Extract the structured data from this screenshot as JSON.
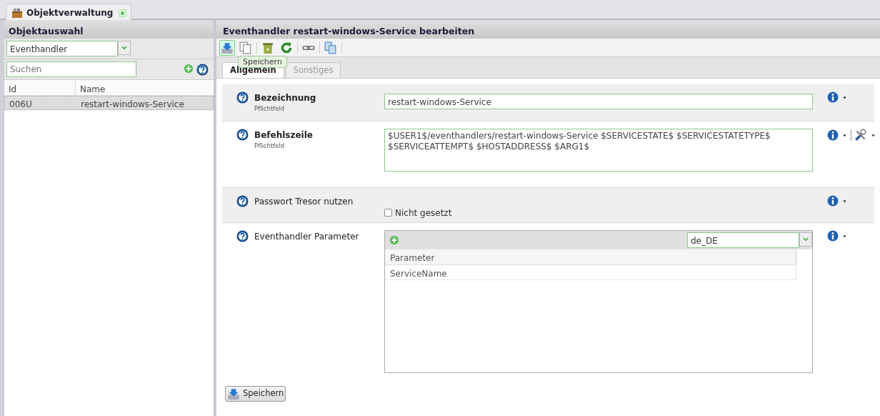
{
  "tab": {
    "label": "Objektverwaltung"
  },
  "left": {
    "title": "Objektauswahl",
    "type_select": {
      "value": "Eventhandler"
    },
    "search": {
      "placeholder": "Suchen"
    },
    "columns": [
      "Id",
      "Name"
    ],
    "rows": [
      {
        "cells": [
          "006U",
          "restart-windows-Service"
        ],
        "selected": true
      }
    ]
  },
  "editor": {
    "title": "Eventhandler restart-windows-Service bearbeiten",
    "toolbar": [
      {
        "kind": "save",
        "hovered": true
      },
      {
        "kind": "copy",
        "hovered": false
      },
      {
        "kind": "sep"
      },
      {
        "kind": "archive",
        "hovered": false
      },
      {
        "kind": "refresh",
        "hovered": false
      },
      {
        "kind": "sep"
      },
      {
        "kind": "link",
        "hovered": false
      },
      {
        "kind": "sep"
      },
      {
        "kind": "duplicate",
        "hovered": false
      },
      {
        "kind": "sep"
      }
    ],
    "tooltip": "Speichern",
    "tabs": [
      {
        "label": "Allgemein",
        "selected": true
      },
      {
        "label": "Sonstiges",
        "selected": false
      }
    ],
    "fields": [
      {
        "kind": "text",
        "label": "Bezeichnung",
        "required": true,
        "hint": "Pflichtfeld",
        "value": "restart-windows-Service",
        "tools": false
      },
      {
        "kind": "textarea",
        "label": "Befehlszeile",
        "required": true,
        "hint": "Pflichtfeld",
        "value": "$USER1$/eventhandlers/restart-windows-Service $SERVICESTATE$ $SERVICESTATETYPE$ $SERVICEATTEMPT$ $HOSTADDRESS$ $ARG1$",
        "tools": true
      },
      {
        "kind": "checkbox",
        "label": "Passwort Tresor nutzen",
        "required": false,
        "checked": false,
        "value": "Nicht gesetzt",
        "tools": false
      },
      {
        "kind": "table",
        "label": "Eventhandler Parameter",
        "required": false,
        "locale": "de_DE",
        "columns": [
          "Parameter"
        ],
        "rows": [
          "ServiceName"
        ],
        "tools": false
      }
    ],
    "save_button": "Speichern"
  }
}
